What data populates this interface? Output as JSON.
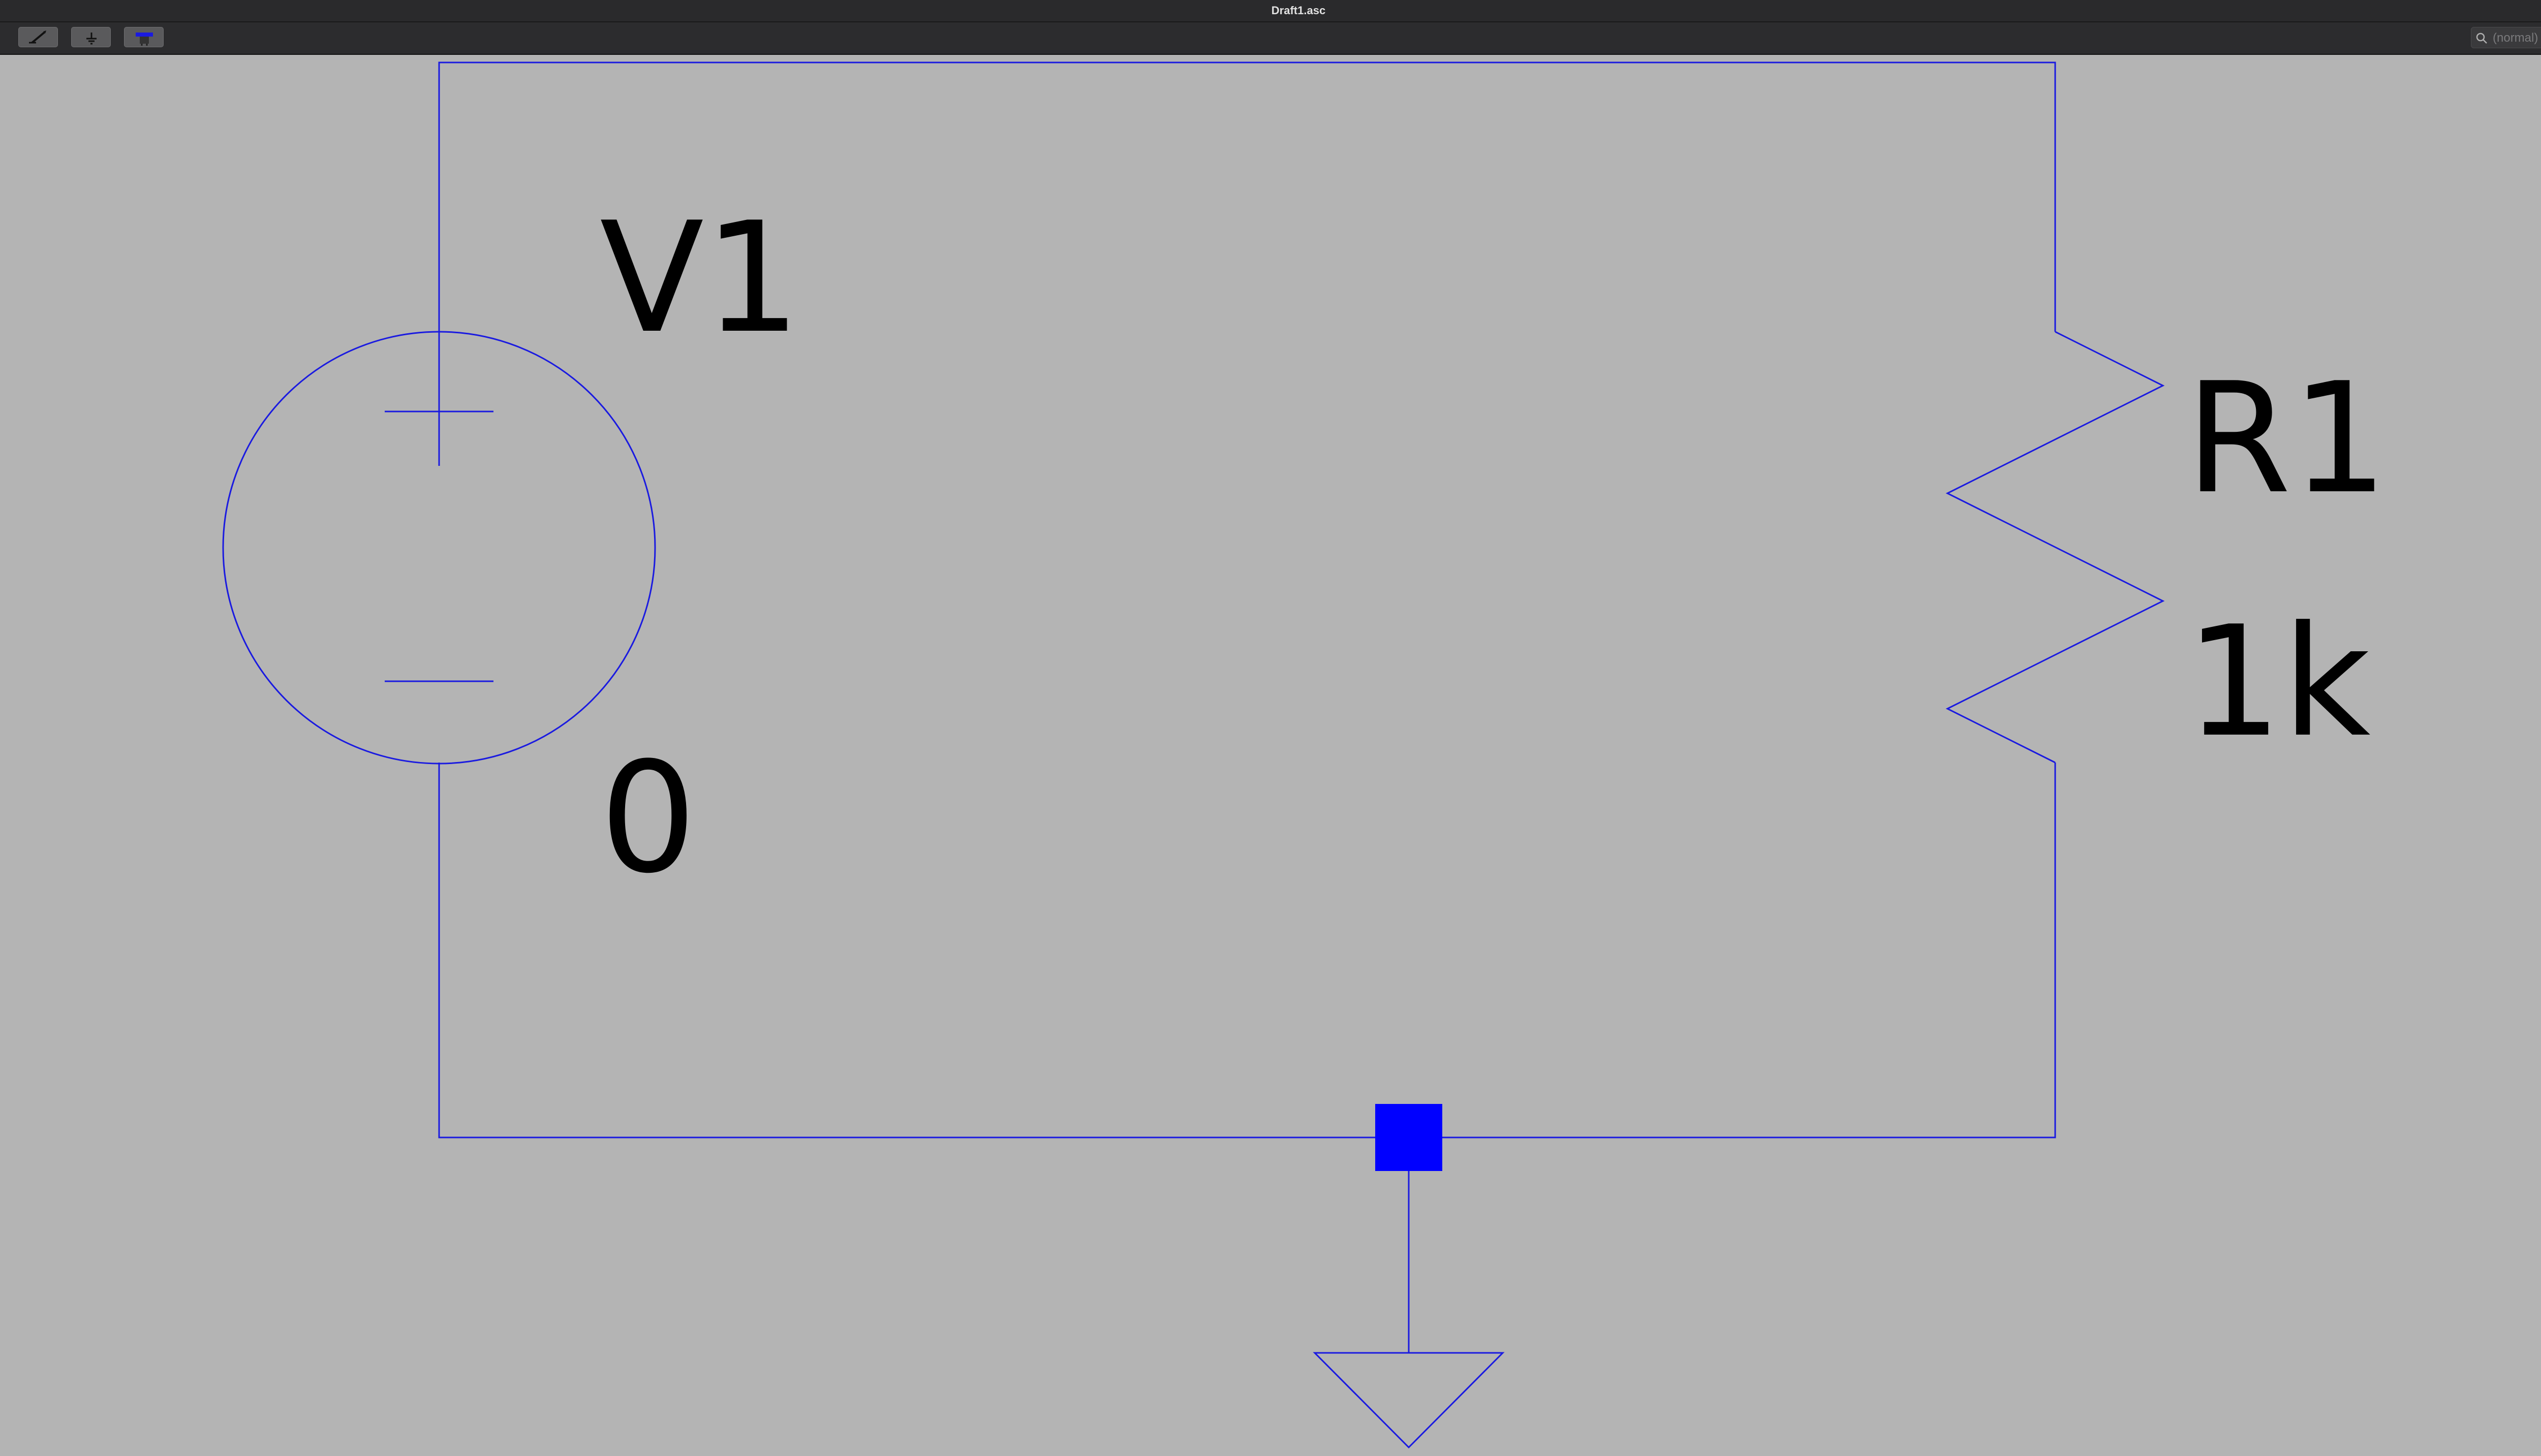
{
  "window": {
    "title": "Draft1.asc",
    "new_tab_symbol": "+"
  },
  "toolbar": {
    "buttons": [
      {
        "name": "wire-tool-button",
        "icon": "pencil-wire-icon"
      },
      {
        "name": "ground-tool-button",
        "icon": "ground-icon"
      },
      {
        "name": "component-tool-button",
        "icon": "component-icon"
      }
    ],
    "search": {
      "placeholder": "(normal)",
      "value": ""
    }
  },
  "schematic": {
    "wire_color": "#1a1ae0",
    "background_color": "#b4b4b4",
    "components": {
      "voltage_source": {
        "name": "V1",
        "value": "0"
      },
      "resistor": {
        "name": "R1",
        "value": "1k"
      }
    },
    "ground": {
      "icon": "ground-symbol-icon"
    },
    "junction": {
      "icon": "net-node-icon"
    }
  }
}
